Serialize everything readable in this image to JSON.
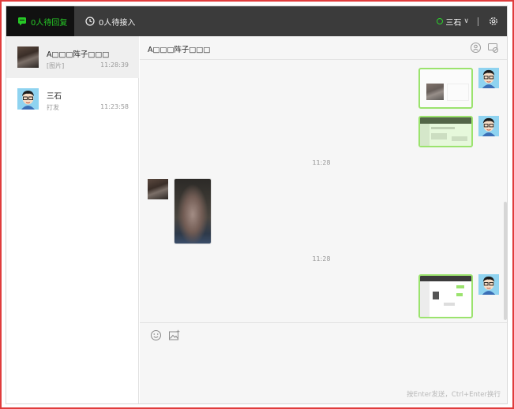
{
  "topbar": {
    "tab_pending_reply": "0人待回复",
    "tab_pending_accept": "0人待接入",
    "user_name": "三石",
    "chevron": "∨",
    "accent_color": "#26c826"
  },
  "conversations": [
    {
      "name": "A□□□阵子□□□",
      "preview": "[图片]",
      "time": "11:28:39",
      "avatar": "photo"
    },
    {
      "name": "三石",
      "preview": "打发",
      "time": "11:23:58",
      "avatar": "cartoon-boy"
    }
  ],
  "chat": {
    "title": "A□□□阵子□□□",
    "timestamps": [
      "11:28",
      "11:28"
    ],
    "input_hint": "按Enter发送，Ctrl+Enter换行"
  },
  "icons": {
    "pending_reply": "chat-bubble-icon",
    "pending_accept": "clock-icon",
    "settings": "gear-icon",
    "transfer": "person-transfer-icon",
    "end_session": "chat-off-icon",
    "emoji": "smiley-icon",
    "image": "image-icon"
  }
}
